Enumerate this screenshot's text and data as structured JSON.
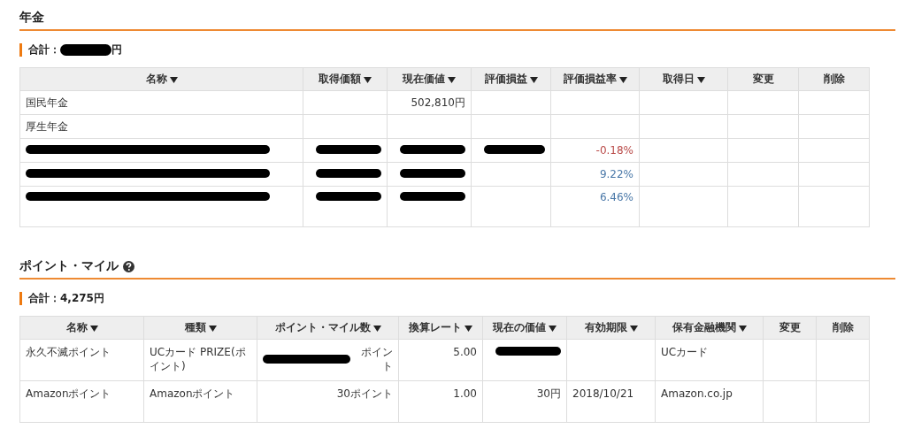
{
  "sections": [
    {
      "title": "年金",
      "total": {
        "label": "合計：",
        "redacted": true,
        "suffix": "円"
      },
      "table": {
        "columns": [
          {
            "label": "名称",
            "sortable": true
          },
          {
            "label": "取得価額",
            "sortable": true
          },
          {
            "label": "現在価値",
            "sortable": true
          },
          {
            "label": "評価損益",
            "sortable": true
          },
          {
            "label": "評価損益率",
            "sortable": true
          },
          {
            "label": "取得日",
            "sortable": true
          },
          {
            "label": "変更",
            "sortable": false
          },
          {
            "label": "削除",
            "sortable": false
          }
        ],
        "rows": [
          {
            "cells": [
              {
                "text": "国民年金"
              },
              {
                "text": ""
              },
              {
                "text": "502,810円"
              },
              {
                "text": ""
              },
              {
                "text": ""
              },
              {
                "text": ""
              },
              {
                "text": ""
              },
              {
                "text": ""
              }
            ]
          },
          {
            "cells": [
              {
                "text": "厚生年金"
              },
              {
                "text": ""
              },
              {
                "text": ""
              },
              {
                "text": ""
              },
              {
                "text": ""
              },
              {
                "text": ""
              },
              {
                "text": ""
              },
              {
                "text": ""
              }
            ]
          },
          {
            "cells": [
              {
                "text": "",
                "redacted": true
              },
              {
                "text": "",
                "redacted": true
              },
              {
                "text": "",
                "redacted": true
              },
              {
                "text": "",
                "redacted": true
              },
              {
                "text": "-0.18%",
                "color": "#b94a48"
              },
              {
                "text": ""
              },
              {
                "text": ""
              },
              {
                "text": ""
              }
            ]
          },
          {
            "cells": [
              {
                "text": "",
                "redacted": true
              },
              {
                "text": "",
                "redacted": true
              },
              {
                "text": "",
                "redacted": true
              },
              {
                "text": ""
              },
              {
                "text": "9.22%",
                "color": "#4a78a8"
              },
              {
                "text": ""
              },
              {
                "text": ""
              },
              {
                "text": ""
              }
            ]
          },
          {
            "cells": [
              {
                "text": "",
                "redacted": true
              },
              {
                "text": "",
                "redacted": true
              },
              {
                "text": "",
                "redacted": true
              },
              {
                "text": ""
              },
              {
                "text": "6.46%",
                "color": "#4a78a8"
              },
              {
                "text": ""
              },
              {
                "text": ""
              },
              {
                "text": ""
              }
            ]
          }
        ]
      }
    },
    {
      "title": "ポイント・マイル",
      "help_icon": true,
      "total": {
        "label": "合計：",
        "value": "4,275",
        "suffix": "円"
      },
      "table": {
        "columns": [
          {
            "label": "名称",
            "sortable": true
          },
          {
            "label": "種類",
            "sortable": true
          },
          {
            "label": "ポイント・マイル数",
            "sortable": true
          },
          {
            "label": "換算レート",
            "sortable": true
          },
          {
            "label": "現在の価値",
            "sortable": true
          },
          {
            "label": "有効期限",
            "sortable": true
          },
          {
            "label": "保有金融機関",
            "sortable": true
          },
          {
            "label": "変更",
            "sortable": false
          },
          {
            "label": "削除",
            "sortable": false
          }
        ],
        "rows": [
          {
            "cells": [
              {
                "text": "永久不滅ポイント"
              },
              {
                "text": "UCカード PRIZE(ポイント)"
              },
              {
                "text": "ポイント",
                "redacted": true
              },
              {
                "text": "5.00"
              },
              {
                "text": "",
                "redacted": true
              },
              {
                "text": ""
              },
              {
                "text": "UCカード"
              },
              {
                "text": ""
              },
              {
                "text": ""
              }
            ]
          },
          {
            "cells": [
              {
                "text": "Amazonポイント"
              },
              {
                "text": "Amazonポイント"
              },
              {
                "text": "30ポイント"
              },
              {
                "text": "1.00"
              },
              {
                "text": "30円"
              },
              {
                "text": "2018/10/21"
              },
              {
                "text": "Amazon.co.jp"
              },
              {
                "text": ""
              },
              {
                "text": ""
              }
            ]
          }
        ]
      }
    }
  ]
}
